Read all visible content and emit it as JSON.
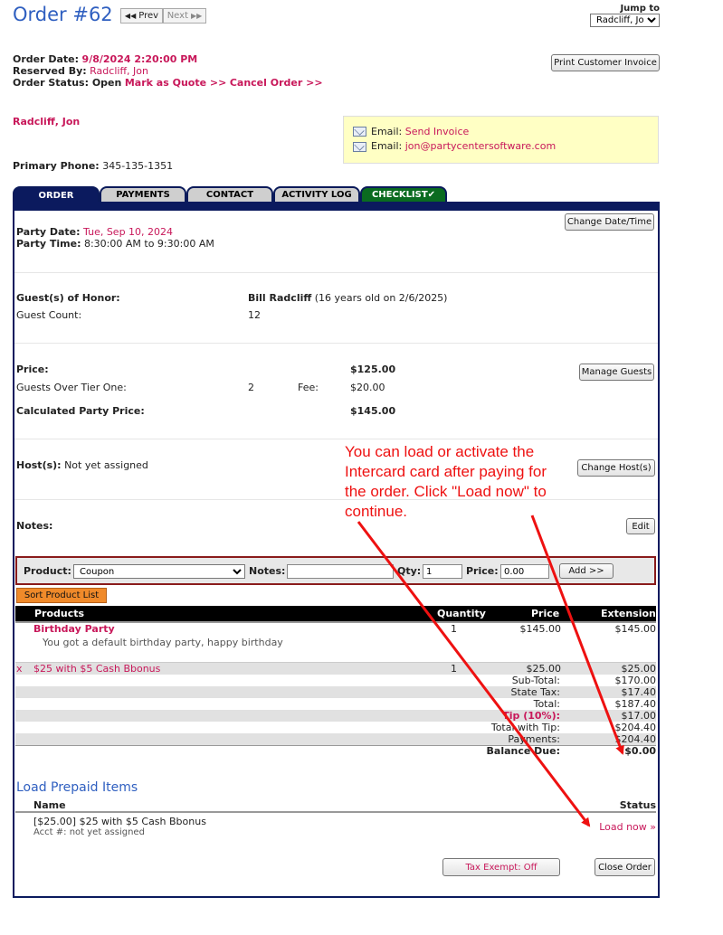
{
  "header": {
    "title": "Order #62",
    "prev_label": "Prev",
    "next_label": "Next",
    "jump_label": "Jump to order:",
    "jump_value": "Radcliff, Jon",
    "print_invoice_label": "Print Customer Invoice"
  },
  "order": {
    "date_label": "Order Date:",
    "date_value": "9/8/2024 2:20:00 PM",
    "reserved_label": "Reserved By:",
    "reserved_value": "Radcliff, Jon",
    "status_label": "Order Status: Open",
    "mark_quote": "Mark as Quote >>",
    "cancel_order": "Cancel Order >>"
  },
  "customer": {
    "name": "Radcliff, Jon",
    "phone_label": "Primary Phone:",
    "phone_value": "345-135-1351",
    "email_label_1": "Email:",
    "send_invoice": "Send Invoice",
    "email_label_2": "Email:",
    "email_value": "jon@partycentersoftware.com"
  },
  "tabs": [
    {
      "label": "ORDER"
    },
    {
      "label": "PAYMENTS"
    },
    {
      "label": "CONTACT"
    },
    {
      "label": "ACTIVITY LOG"
    },
    {
      "label": "CHECKLIST✔"
    }
  ],
  "party": {
    "date_label": "Party Date:",
    "date_value": "Tue, Sep 10, 2024",
    "time_label": "Party Time:",
    "time_value": "8:30:00 AM to 9:30:00 AM",
    "change_datetime": "Change Date/Time"
  },
  "guests": {
    "honor_label": "Guest(s) of Honor:",
    "honor_name": "Bill Radcliff",
    "honor_age": "(16 years old on 2/6/2025)",
    "count_label": "Guest Count:",
    "count_value": "12"
  },
  "pricing": {
    "price_label": "Price:",
    "price_value": "$125.00",
    "over_tier_label": "Guests Over Tier One:",
    "over_tier_count": "2",
    "fee_label": "Fee:",
    "fee_value": "$20.00",
    "calc_label": "Calculated Party Price:",
    "calc_value": "$145.00",
    "manage_guests": "Manage Guests"
  },
  "hosts": {
    "label": "Host(s):",
    "value": "Not yet assigned",
    "change_hosts": "Change Host(s)"
  },
  "notes": {
    "label": "Notes:",
    "edit": "Edit"
  },
  "annotation": "You can load or activate the Intercard card after paying for the order. Click \"Load now\" to continue.",
  "product_bar": {
    "product_label": "Product:",
    "product_value": "Coupon",
    "notes_label": "Notes:",
    "qty_label": "Qty:",
    "qty_value": "1",
    "price_label": "Price:",
    "price_value": "0.00",
    "add_button": "Add >>",
    "sort_button": "Sort Product List"
  },
  "table": {
    "headers": {
      "products": "Products",
      "quantity": "Quantity",
      "price": "Price",
      "extension": "Extension"
    },
    "rows": [
      {
        "name": "Birthday Party",
        "desc": "You got a default birthday party, happy birthday",
        "qty": "1",
        "price": "$145.00",
        "ext": "$145.00"
      },
      {
        "remove": "x",
        "name": "$25 with $5 Cash Bbonus",
        "qty": "1",
        "price": "$25.00",
        "ext": "$25.00"
      }
    ]
  },
  "totals": {
    "subtotal_label": "Sub-Total:",
    "subtotal": "$170.00",
    "tax_label": "State Tax:",
    "tax": "$17.40",
    "total_label": "Total:",
    "total": "$187.40",
    "tip_label": "Tip (10%):",
    "tip": "$17.00",
    "total_tip_label": "Total with Tip:",
    "total_tip": "$204.40",
    "payments_label": "Payments:",
    "payments": "$204.40",
    "balance_label": "Balance Due:",
    "balance": "$0.00"
  },
  "prepaid": {
    "title": "Load Prepaid Items",
    "name_header": "Name",
    "status_header": "Status",
    "item": "[$25.00] $25 with $5 Cash Bbonus",
    "acct": "Acct #: not yet assigned",
    "load_now": "Load now »"
  },
  "footer": {
    "tax_exempt": "Tax Exempt: Off",
    "close_order": "Close Order"
  },
  "colors": {
    "accent": "#c8185a",
    "tab_navy": "#0b1a5e",
    "checklist_green": "#0a6b20",
    "annotation_red": "#ee1111"
  }
}
